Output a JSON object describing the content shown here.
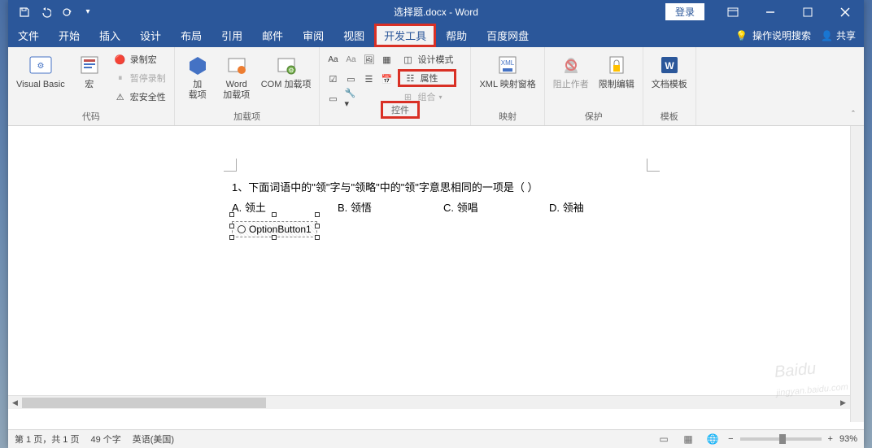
{
  "titlebar": {
    "doc_title": "选择题.docx - Word",
    "login": "登录"
  },
  "tabs": {
    "file": "文件",
    "home": "开始",
    "insert": "插入",
    "design": "设计",
    "layout": "布局",
    "references": "引用",
    "mailings": "邮件",
    "review": "审阅",
    "view": "视图",
    "developer": "开发工具",
    "help": "帮助",
    "baidu": "百度网盘",
    "tell_me": "操作说明搜索",
    "share": "共享"
  },
  "ribbon": {
    "code": {
      "visual_basic": "Visual Basic",
      "macros": "宏",
      "record_macro": "录制宏",
      "pause_recording": "暂停录制",
      "macro_security": "宏安全性",
      "group": "代码"
    },
    "addins": {
      "addins": "加\n载项",
      "word_addins": "Word\n加载项",
      "com_addins": "COM 加载项",
      "group": "加载项"
    },
    "controls": {
      "design_mode": "设计模式",
      "properties": "属性",
      "group_ctrl": "组合",
      "group": "控件"
    },
    "mapping": {
      "xml_mapping": "XML 映射窗格",
      "group": "映射"
    },
    "protect": {
      "block_authors": "阻止作者",
      "restrict_editing": "限制编辑",
      "group": "保护"
    },
    "template": {
      "doc_template": "文档模板",
      "group": "模板"
    }
  },
  "document": {
    "question": "1、下面词语中的\"领\"字与\"领略\"中的\"领\"字意思相同的一项是（    ）",
    "opt_a": "A.  领土",
    "opt_b": "B.  领悟",
    "opt_c": "C.  领唱",
    "opt_d": "D.  领袖",
    "control_label": "OptionButton1"
  },
  "statusbar": {
    "page": "第 1 页，共 1 页",
    "words": "49 个字",
    "language": "英语(美国)",
    "zoom": "93%"
  }
}
